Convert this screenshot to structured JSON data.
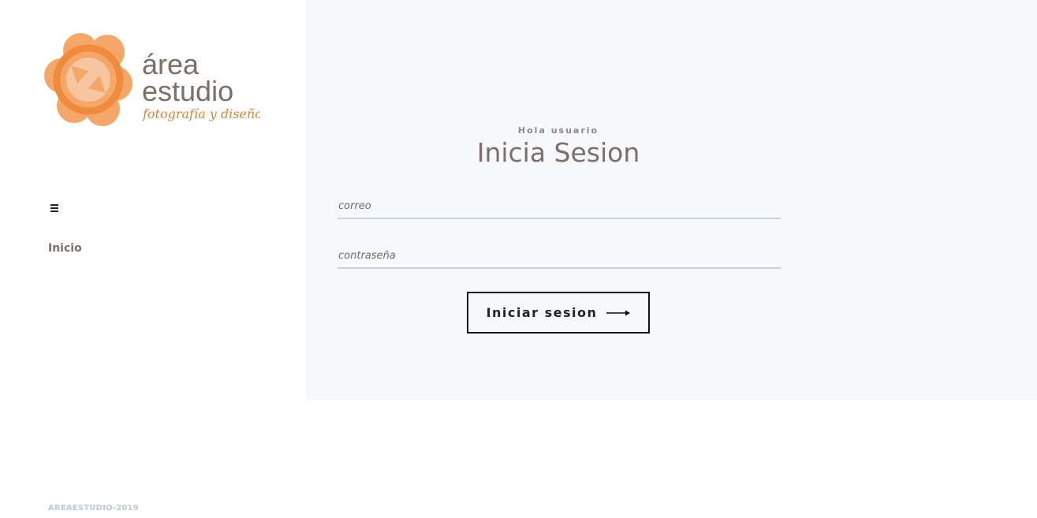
{
  "brand": {
    "logo_line1": "área",
    "logo_line2": "estudio",
    "logo_tagline": "fotografía y diseño",
    "primary_color": "#f08a3c",
    "light_color": "#f5a76a"
  },
  "sidebar": {
    "menu_icon": "hamburger-icon",
    "nav_items": [
      {
        "label": "Inicio"
      }
    ],
    "footer": "AREAESTUDIO-2019"
  },
  "login": {
    "greeting": "Hola usuario",
    "title": "Inicia Sesion",
    "email_placeholder": "correo",
    "password_placeholder": "contraseña",
    "submit_label": "Iniciar sesion",
    "submit_icon": "arrow-right-icon"
  }
}
